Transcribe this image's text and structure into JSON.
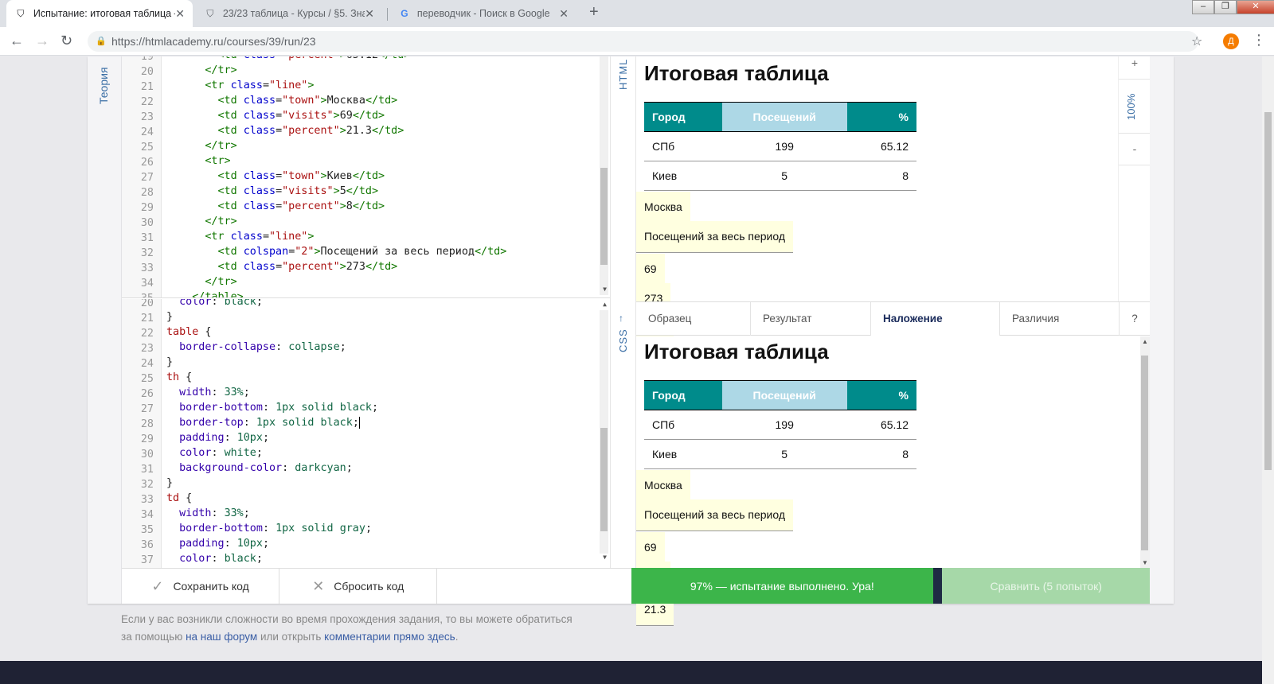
{
  "browser": {
    "tabs": [
      {
        "title": "Испытание: итоговая таблица –",
        "active": true
      },
      {
        "title": "23/23 таблица - Курсы / §5. Зна",
        "active": false
      },
      {
        "title": "переводчик - Поиск в Google",
        "active": false
      }
    ],
    "url_host": "https://htmlacademy.ru",
    "url_path": "/courses/39/run/23",
    "avatar_letter": "Д"
  },
  "sidebar": {
    "theory_label": "Теория"
  },
  "editor": {
    "html_label": "HTML",
    "css_label": "CSS",
    "arrow": "↑",
    "html_lines": [
      "19",
      "20",
      "21",
      "22",
      "23",
      "24",
      "25",
      "26",
      "27",
      "28",
      "29",
      "30",
      "31",
      "32",
      "33",
      "34",
      "35"
    ],
    "css_lines": [
      "20",
      "21",
      "22",
      "23",
      "24",
      "25",
      "26",
      "27",
      "28",
      "29",
      "30",
      "31",
      "32",
      "33",
      "34",
      "35",
      "36",
      "37"
    ]
  },
  "preview": {
    "title": "Итоговая таблица",
    "headers": [
      "Город",
      "Посещений",
      "%"
    ],
    "rows": [
      {
        "town": "СПб",
        "visits": "199",
        "percent": "65.12"
      },
      {
        "town": "Москва",
        "visits": "69",
        "percent": "21.3"
      },
      {
        "town": "Киев",
        "visits": "5",
        "percent": "8"
      }
    ],
    "total_label": "Посещений за весь период",
    "total_value": "273",
    "zoom": "100%",
    "zoom_in": "+",
    "zoom_out": "-"
  },
  "compare_tabs": [
    "Образец",
    "Результат",
    "Наложение",
    "Различия",
    "?"
  ],
  "actions": {
    "save": "Сохранить код",
    "reset": "Сбросить код",
    "status": "97% — испытание выполнено. Ура!",
    "compare": "Сравнить (5 попыток)"
  },
  "footer": {
    "text1": "Если у вас возникли сложности во время прохождения задания, то вы можете обратиться",
    "text2a": "за помощью ",
    "link1": "на наш форум",
    "text2b": " или открыть ",
    "link2": "комментарии прямо здесь",
    "text2c": "."
  },
  "colors": {
    "accent": "#008b8b",
    "status_ok": "#3cb54a",
    "compare_btn": "#a6d8a8"
  }
}
